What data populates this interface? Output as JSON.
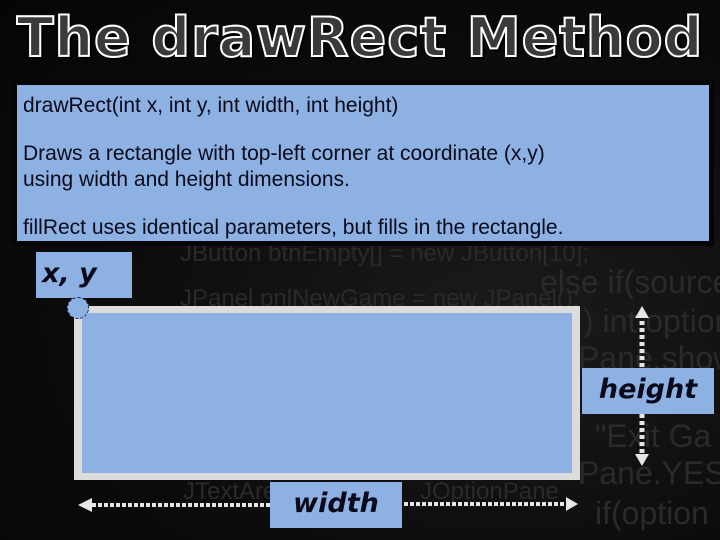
{
  "slide": {
    "title": "The drawRect Method",
    "info": {
      "signature": "drawRect(int x, int y, int width, int height)",
      "description_line1": "Draws a rectangle with top-left corner at coordinate (x,y)",
      "description_line2": "using width and height dimensions.",
      "note": "fillRect uses identical parameters, but fills in the rectangle."
    },
    "diagram": {
      "corner_label": "x, y",
      "height_label": "height",
      "width_label": "width"
    },
    "background_code": [
      "JButton btnEmpty[] = new JButton[10];",
      "JPanel    pnlNewGame = new JPanel();",
      "else if(source",
      ") int option",
      "Pane.show",
      "\"Exit Ga",
      "Pane.YES",
      "if(option",
      "JTextArea",
      "JOptionPane"
    ],
    "colors": {
      "box_fill": "#8db1e2",
      "rect_border": "#dcdcdc",
      "background": "#0c0c0c",
      "text": "#0a0a1a"
    }
  }
}
